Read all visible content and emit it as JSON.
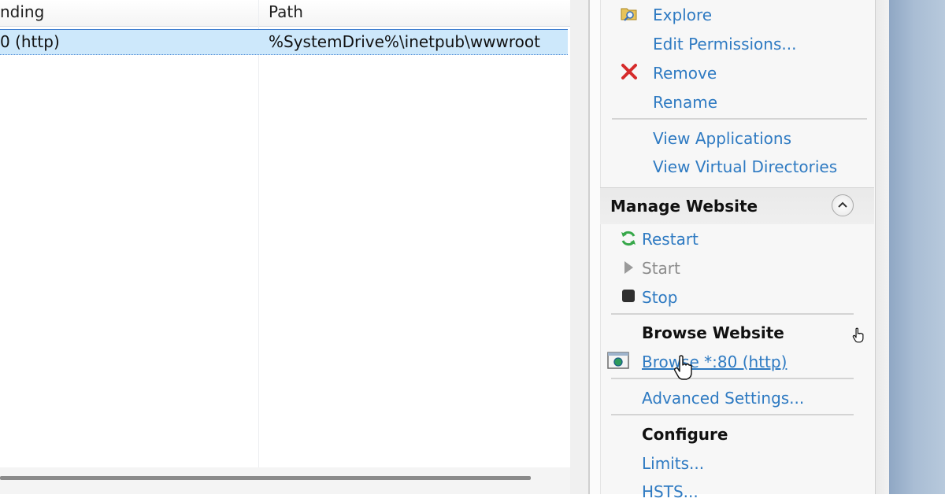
{
  "list": {
    "columns": [
      "nding",
      "Path"
    ],
    "selected_row": {
      "binding": "0 (http)",
      "path": "%SystemDrive%\\inetpub\\wwwroot"
    }
  },
  "actions": {
    "top_items": [
      {
        "label": "Explore",
        "icon": "folder-explore-icon"
      },
      {
        "label": "Edit Permissions...",
        "icon": ""
      },
      {
        "label": "Remove",
        "icon": "red-x-icon"
      },
      {
        "label": "Rename",
        "icon": ""
      }
    ],
    "view_items": [
      "View Applications",
      "View Virtual Directories"
    ],
    "manage_website": {
      "title": "Manage Website",
      "items": [
        {
          "label": "Restart",
          "icon": "restart-icon",
          "enabled": true
        },
        {
          "label": "Start",
          "icon": "start-icon",
          "enabled": false
        },
        {
          "label": "Stop",
          "icon": "stop-icon",
          "enabled": true
        }
      ],
      "browse_heading": "Browse Website",
      "browse_link": "Browse *:80 (http)",
      "advanced": "Advanced Settings...",
      "configure_heading": "Configure",
      "configure_items": [
        "Limits...",
        "HSTS..."
      ]
    }
  },
  "colors": {
    "link": "#2e7ac2",
    "selection": "#cde8fb",
    "remove_icon": "#d62b2b",
    "restart_icon": "#37a84a"
  }
}
